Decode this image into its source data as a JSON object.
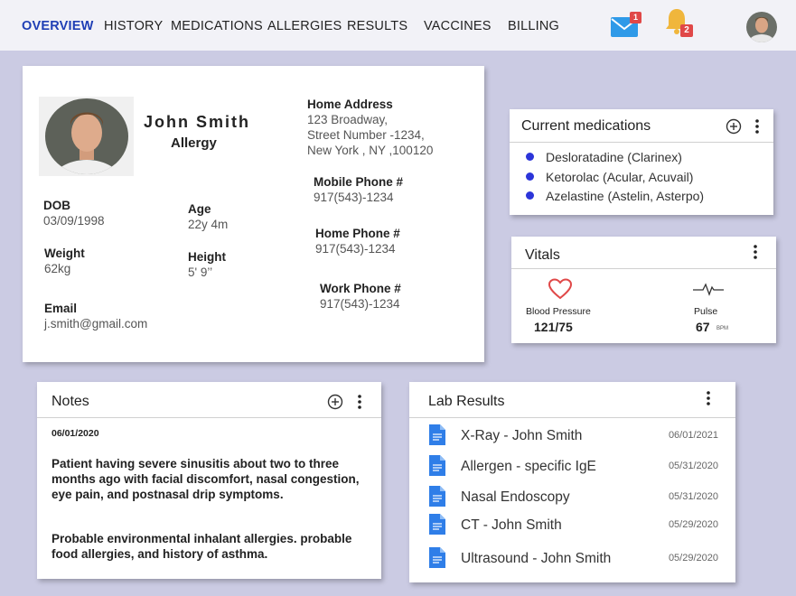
{
  "nav": {
    "items": [
      "OVERVIEW",
      "HISTORY",
      "MEDICATIONS",
      "ALLERGIES",
      "RESULTS",
      "VACCINES",
      "BILLING"
    ],
    "mail_count": "1",
    "notif_count": "2"
  },
  "profile": {
    "name": "John Smith",
    "condition": "Allergy",
    "dob_label": "DOB",
    "dob": "03/09/1998",
    "age_label": "Age",
    "age": "22y 4m",
    "weight_label": "Weight",
    "weight": "62kg",
    "height_label": "Height",
    "height": "5' 9’’",
    "email_label": "Email",
    "email": "j.smith@gmail.com",
    "address_label": "Home Address",
    "address_lines": [
      "123 Broadway,",
      "Street Number -1234,",
      "New York , NY ,100120"
    ],
    "mobile_label": "Mobile Phone #",
    "mobile": "917(543)-1234",
    "home_phone_label": "Home Phone #",
    "home_phone": "917(543)-1234",
    "work_phone_label": "Work Phone #",
    "work_phone": "917(543)-1234"
  },
  "medications": {
    "title": "Current medications",
    "items": [
      "Desloratadine (Clarinex)",
      "Ketorolac (Acular, Acuvail)",
      "Azelastine (Astelin, Asterpo)"
    ]
  },
  "vitals": {
    "title": "Vitals",
    "bp_label": "Blood Pressure",
    "bp_value": "121/75",
    "pulse_label": "Pulse",
    "pulse_value": "67",
    "pulse_unit": "BPM"
  },
  "notes": {
    "title": "Notes",
    "date": "06/01/2020",
    "paragraph1": "Patient having severe sinusitis about two to three months ago with facial discomfort, nasal congestion, eye pain, and postnasal drip symptoms.",
    "paragraph2": "Probable environmental inhalant allergies. probable food allergies, and history of asthma."
  },
  "lab_results": {
    "title": "Lab Results",
    "items": [
      {
        "name": "X-Ray - John Smith",
        "date": "06/01/2021"
      },
      {
        "name": "Allergen - specific IgE",
        "date": "05/31/2020"
      },
      {
        "name": "Nasal Endoscopy",
        "date": "05/31/2020"
      },
      {
        "name": "CT - John Smith",
        "date": "05/29/2020"
      },
      {
        "name": "Ultrasound - John Smith",
        "date": "05/29/2020"
      }
    ]
  },
  "colors": {
    "accent": "#1f3fb5",
    "background": "#cbcbe3",
    "med_dot": "#2c35d9",
    "doc_icon": "#2f7ee8",
    "heart": "#e04848"
  }
}
